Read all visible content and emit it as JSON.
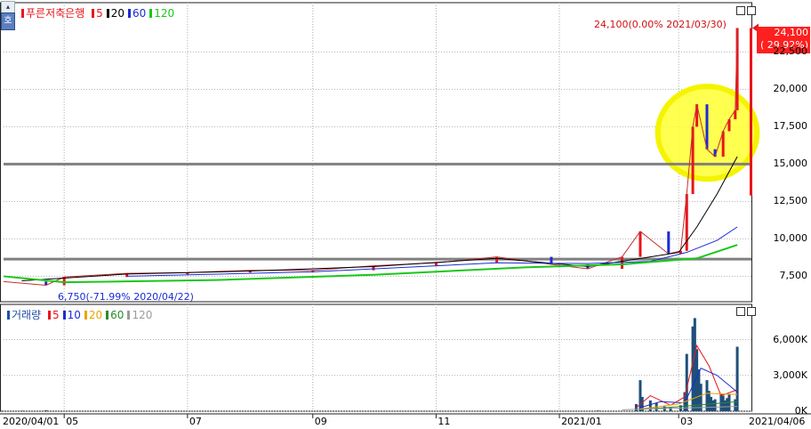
{
  "toolbar": {
    "toggle_label": "호"
  },
  "price_panel": {
    "legend": {
      "name": "푸른저축은행",
      "items": [
        {
          "label": "5",
          "color": "#e8161b"
        },
        {
          "label": "20",
          "color": "#000000"
        },
        {
          "label": "60",
          "color": "#1a2bd6"
        },
        {
          "label": "120",
          "color": "#18c818"
        }
      ]
    },
    "annotation_high": "24,100(0.00% 2021/03/30)",
    "annotation_low": "6,750(-71.99% 2020/04/22)",
    "current_price": "24,100",
    "current_change": "( 29.92%)"
  },
  "volume_panel": {
    "legend": {
      "name": "거래량",
      "items": [
        {
          "label": "5",
          "color": "#e8161b"
        },
        {
          "label": "10",
          "color": "#1a2bd6"
        },
        {
          "label": "20",
          "color": "#e8a500"
        },
        {
          "label": "60",
          "color": "#2b8a2b"
        },
        {
          "label": "120",
          "color": "#9a9a9a"
        }
      ]
    }
  },
  "x_axis": {
    "start_label": "2020/04/01",
    "end_label": "2021/04/06",
    "ticks": [
      "05",
      "07",
      "09",
      "11",
      "2021/01",
      "03"
    ]
  },
  "chart_data": [
    {
      "type": "candlestick",
      "title": "푸른저축은행",
      "y_ticks": [
        "7,500",
        "10,000",
        "12,500",
        "15,000",
        "17,500",
        "20,000",
        "22,500"
      ],
      "ylim": [
        5800,
        25200
      ],
      "x_range": [
        "2020/04/01",
        "2021/04/06"
      ],
      "horizontal_lines": [
        15000,
        8650
      ],
      "highlight": {
        "type": "ellipse",
        "color": "#ffff00",
        "x": [
          "2021/03/03",
          "2021/03/31"
        ],
        "y": [
          14000,
          20200
        ]
      },
      "ohlc_points": [
        {
          "date": "2020/04/01",
          "close": 7150
        },
        {
          "date": "2020/04/22",
          "close": 6900
        },
        {
          "date": "2020/05/01",
          "close": 7450
        },
        {
          "date": "2020/06/01",
          "close": 7700
        },
        {
          "date": "2020/07/01",
          "close": 7750
        },
        {
          "date": "2020/08/01",
          "close": 7900
        },
        {
          "date": "2020/09/01",
          "close": 7900
        },
        {
          "date": "2020/10/01",
          "close": 8200
        },
        {
          "date": "2020/11/01",
          "close": 8400
        },
        {
          "date": "2020/12/01",
          "close": 8800
        },
        {
          "date": "2020/12/28",
          "close": 8300
        },
        {
          "date": "2021/01/15",
          "close": 8000
        },
        {
          "date": "2021/02/01",
          "close": 8800
        },
        {
          "date": "2021/02/10",
          "close": 10500
        },
        {
          "date": "2021/02/24",
          "close": 9000
        },
        {
          "date": "2021/03/02",
          "close": 9200
        },
        {
          "date": "2021/03/05",
          "close": 13000
        },
        {
          "date": "2021/03/08",
          "close": 17500
        },
        {
          "date": "2021/03/10",
          "close": 19000
        },
        {
          "date": "2021/03/15",
          "close": 16000
        },
        {
          "date": "2021/03/19",
          "close": 15500
        },
        {
          "date": "2021/03/23",
          "close": 17200
        },
        {
          "date": "2021/03/26",
          "close": 18000
        },
        {
          "date": "2021/03/29",
          "close": 18600
        },
        {
          "date": "2021/03/30",
          "close": 24100
        }
      ],
      "series": [
        {
          "name": "5",
          "color": "#e8161b",
          "values": []
        },
        {
          "name": "20",
          "color": "#000000",
          "values": [
            {
              "date": "2020/04/10",
              "v": 7200
            },
            {
              "date": "2020/06/01",
              "v": 7650
            },
            {
              "date": "2020/08/01",
              "v": 7850
            },
            {
              "date": "2020/10/01",
              "v": 8150
            },
            {
              "date": "2020/12/01",
              "v": 8700
            },
            {
              "date": "2021/01/15",
              "v": 8150
            },
            {
              "date": "2021/02/15",
              "v": 8800
            },
            {
              "date": "2021/03/01",
              "v": 9100
            },
            {
              "date": "2021/03/10",
              "v": 10800
            },
            {
              "date": "2021/03/20",
              "v": 13000
            },
            {
              "date": "2021/03/30",
              "v": 15500
            }
          ]
        },
        {
          "name": "60",
          "color": "#1a2bd6",
          "values": [
            {
              "date": "2020/06/01",
              "v": 7500
            },
            {
              "date": "2020/09/01",
              "v": 7800
            },
            {
              "date": "2020/12/01",
              "v": 8400
            },
            {
              "date": "2021/01/15",
              "v": 8350
            },
            {
              "date": "2021/02/15",
              "v": 8500
            },
            {
              "date": "2021/03/05",
              "v": 9100
            },
            {
              "date": "2021/03/20",
              "v": 9900
            },
            {
              "date": "2021/03/30",
              "v": 10800
            }
          ]
        },
        {
          "name": "120",
          "color": "#18c818",
          "values": [
            {
              "date": "2020/04/01",
              "v": 7500
            },
            {
              "date": "2020/05/01",
              "v": 7100
            },
            {
              "date": "2020/07/15",
              "v": 7250
            },
            {
              "date": "2020/10/01",
              "v": 7600
            },
            {
              "date": "2020/12/15",
              "v": 8100
            },
            {
              "date": "2021/02/01",
              "v": 8300
            },
            {
              "date": "2021/03/10",
              "v": 8700
            },
            {
              "date": "2021/03/30",
              "v": 9600
            }
          ]
        }
      ]
    },
    {
      "type": "bar",
      "title": "거래량",
      "y_ticks": [
        "0K",
        "3,000K",
        "6,000K"
      ],
      "ylim": [
        0,
        8500
      ],
      "values": [
        {
          "date": "2020/04/10",
          "v": 50
        },
        {
          "date": "2020/04/22",
          "v": 80
        },
        {
          "date": "2020/12/28",
          "v": 40
        },
        {
          "date": "2021/01/20",
          "v": 60
        },
        {
          "date": "2021/02/08",
          "v": 600
        },
        {
          "date": "2021/02/10",
          "v": 2600
        },
        {
          "date": "2021/02/11",
          "v": 1200
        },
        {
          "date": "2021/02/15",
          "v": 900
        },
        {
          "date": "2021/02/18",
          "v": 700
        },
        {
          "date": "2021/02/22",
          "v": 400
        },
        {
          "date": "2021/02/25",
          "v": 300
        },
        {
          "date": "2021/03/02",
          "v": 500
        },
        {
          "date": "2021/03/04",
          "v": 1600
        },
        {
          "date": "2021/03/05",
          "v": 4800
        },
        {
          "date": "2021/03/08",
          "v": 7100
        },
        {
          "date": "2021/03/09",
          "v": 7800
        },
        {
          "date": "2021/03/10",
          "v": 5200
        },
        {
          "date": "2021/03/11",
          "v": 3500
        },
        {
          "date": "2021/03/12",
          "v": 2300
        },
        {
          "date": "2021/03/15",
          "v": 2600
        },
        {
          "date": "2021/03/16",
          "v": 1700
        },
        {
          "date": "2021/03/17",
          "v": 1200
        },
        {
          "date": "2021/03/18",
          "v": 900
        },
        {
          "date": "2021/03/19",
          "v": 1000
        },
        {
          "date": "2021/03/22",
          "v": 1500
        },
        {
          "date": "2021/03/23",
          "v": 1300
        },
        {
          "date": "2021/03/24",
          "v": 900
        },
        {
          "date": "2021/03/25",
          "v": 1100
        },
        {
          "date": "2021/03/26",
          "v": 1400
        },
        {
          "date": "2021/03/29",
          "v": 1000
        },
        {
          "date": "2021/03/30",
          "v": 5400
        }
      ],
      "series": [
        {
          "name": "5",
          "color": "#e8161b",
          "values": [
            {
              "date": "2021/02/08",
              "v": 300
            },
            {
              "date": "2021/02/15",
              "v": 1300
            },
            {
              "date": "2021/02/25",
              "v": 500
            },
            {
              "date": "2021/03/04",
              "v": 1200
            },
            {
              "date": "2021/03/10",
              "v": 5500
            },
            {
              "date": "2021/03/16",
              "v": 3800
            },
            {
              "date": "2021/03/22",
              "v": 1300
            },
            {
              "date": "2021/03/30",
              "v": 1800
            }
          ]
        },
        {
          "name": "10",
          "color": "#1a2bd6",
          "values": [
            {
              "date": "2021/02/10",
              "v": 300
            },
            {
              "date": "2021/02/20",
              "v": 800
            },
            {
              "date": "2021/03/04",
              "v": 700
            },
            {
              "date": "2021/03/12",
              "v": 3600
            },
            {
              "date": "2021/03/20",
              "v": 3000
            },
            {
              "date": "2021/03/30",
              "v": 1600
            }
          ]
        },
        {
          "name": "20",
          "color": "#e8a500",
          "values": [
            {
              "date": "2021/02/10",
              "v": 200
            },
            {
              "date": "2021/03/01",
              "v": 600
            },
            {
              "date": "2021/03/15",
              "v": 1500
            },
            {
              "date": "2021/03/30",
              "v": 1400
            }
          ]
        },
        {
          "name": "60",
          "color": "#2b8a2b",
          "values": [
            {
              "date": "2021/02/10",
              "v": 150
            },
            {
              "date": "2021/03/10",
              "v": 500
            },
            {
              "date": "2021/03/30",
              "v": 800
            }
          ]
        },
        {
          "name": "120",
          "color": "#9a9a9a",
          "values": [
            {
              "date": "2021/02/01",
              "v": 120
            },
            {
              "date": "2021/03/30",
              "v": 400
            }
          ]
        }
      ]
    }
  ]
}
